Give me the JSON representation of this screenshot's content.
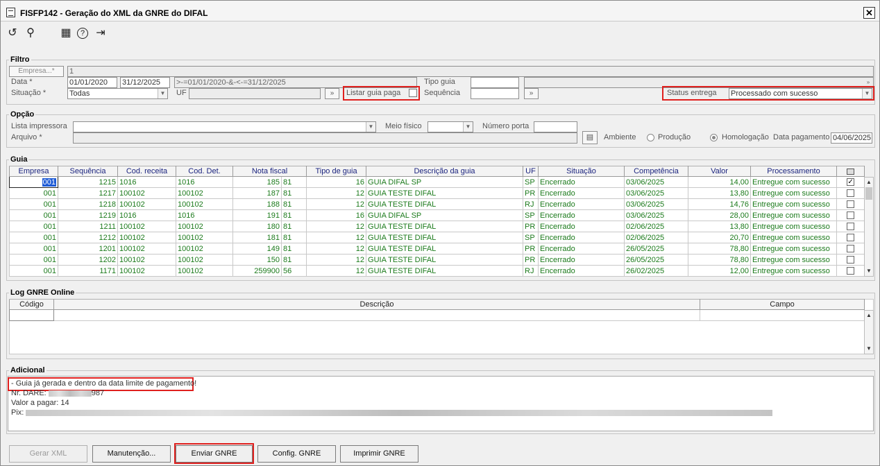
{
  "window": {
    "title": "FISFP142 - Geração do XML da GNRE do DIFAL",
    "close_label": "✕"
  },
  "toolbar": {
    "undo_glyph": "↺",
    "search_glyph": "⚲",
    "calendar_glyph": "▦",
    "help_glyph": "?",
    "exit_glyph": "⇥"
  },
  "filtro": {
    "group_label": "Filtro",
    "empresa_button": "Empresa...*",
    "empresa_value": "1",
    "data_label": "Data *",
    "data_from": "01/01/2020",
    "data_to": "31/12/2025",
    "data_expr": ">-=01/01/2020-&-<-=31/12/2025",
    "tipo_guia_label": "Tipo guia",
    "tipo_guia_value": "",
    "situacao_label": "Situação *",
    "situacao_value": "Todas",
    "uf_label": "UF",
    "uf_value": "",
    "listar_guia_paga_label": "Listar guia paga",
    "sequencia_label": "Sequência",
    "sequencia_value": "",
    "status_entrega_label": "Status entrega",
    "status_entrega_value": "Processado com sucesso",
    "lookup_glyph": "»"
  },
  "opcao": {
    "group_label": "Opção",
    "lista_impressora_label": "Lista impressora",
    "lista_impressora_value": "",
    "meio_fisico_label": "Meio físico",
    "meio_fisico_value": "",
    "numero_porta_label": "Número porta",
    "numero_porta_value": "",
    "arquivo_label": "Arquivo *",
    "arquivo_value": "",
    "ambiente_label": "Ambiente",
    "producao_label": "Produção",
    "homologacao_label": "Homologação",
    "data_pagamento_label": "Data pagamento",
    "data_pagamento_value": "04/06/2025",
    "browse_glyph": "▤"
  },
  "guia": {
    "group_label": "Guia",
    "columns": [
      "Empresa",
      "Sequência",
      "Cod. receita",
      "Cod. Det.",
      "Nota fiscal",
      "Tipo de guia",
      "Descrição da guia",
      "UF",
      "Situação",
      "Competência",
      "Valor",
      "Processamento"
    ],
    "rows": [
      {
        "empresa": "001",
        "sequencia": "1215",
        "cod_receita": "1016",
        "cod_det": "1016",
        "nf": "185",
        "nf2": "81",
        "tipo": "16",
        "descricao": "GUIA DIFAL SP",
        "uf": "SP",
        "situacao": "Encerrado",
        "competencia": "03/06/2025",
        "valor": "14,00",
        "processamento": "Entregue com sucesso",
        "checked": true
      },
      {
        "empresa": "001",
        "sequencia": "1217",
        "cod_receita": "100102",
        "cod_det": "100102",
        "nf": "187",
        "nf2": "81",
        "tipo": "12",
        "descricao": "GUIA TESTE DIFAL",
        "uf": "PR",
        "situacao": "Encerrado",
        "competencia": "03/06/2025",
        "valor": "13,80",
        "processamento": "Entregue com sucesso",
        "checked": false
      },
      {
        "empresa": "001",
        "sequencia": "1218",
        "cod_receita": "100102",
        "cod_det": "100102",
        "nf": "188",
        "nf2": "81",
        "tipo": "12",
        "descricao": "GUIA TESTE DIFAL",
        "uf": "RJ",
        "situacao": "Encerrado",
        "competencia": "03/06/2025",
        "valor": "14,76",
        "processamento": "Entregue com sucesso",
        "checked": false
      },
      {
        "empresa": "001",
        "sequencia": "1219",
        "cod_receita": "1016",
        "cod_det": "1016",
        "nf": "191",
        "nf2": "81",
        "tipo": "16",
        "descricao": "GUIA DIFAL SP",
        "uf": "SP",
        "situacao": "Encerrado",
        "competencia": "03/06/2025",
        "valor": "28,00",
        "processamento": "Entregue com sucesso",
        "checked": false
      },
      {
        "empresa": "001",
        "sequencia": "1211",
        "cod_receita": "100102",
        "cod_det": "100102",
        "nf": "180",
        "nf2": "81",
        "tipo": "12",
        "descricao": "GUIA TESTE DIFAL",
        "uf": "PR",
        "situacao": "Encerrado",
        "competencia": "02/06/2025",
        "valor": "13,80",
        "processamento": "Entregue com sucesso",
        "checked": false
      },
      {
        "empresa": "001",
        "sequencia": "1212",
        "cod_receita": "100102",
        "cod_det": "100102",
        "nf": "181",
        "nf2": "81",
        "tipo": "12",
        "descricao": "GUIA TESTE DIFAL",
        "uf": "SP",
        "situacao": "Encerrado",
        "competencia": "02/06/2025",
        "valor": "20,70",
        "processamento": "Entregue com sucesso",
        "checked": false
      },
      {
        "empresa": "001",
        "sequencia": "1201",
        "cod_receita": "100102",
        "cod_det": "100102",
        "nf": "149",
        "nf2": "81",
        "tipo": "12",
        "descricao": "GUIA TESTE DIFAL",
        "uf": "PR",
        "situacao": "Encerrado",
        "competencia": "26/05/2025",
        "valor": "78,80",
        "processamento": "Entregue com sucesso",
        "checked": false
      },
      {
        "empresa": "001",
        "sequencia": "1202",
        "cod_receita": "100102",
        "cod_det": "100102",
        "nf": "150",
        "nf2": "81",
        "tipo": "12",
        "descricao": "GUIA TESTE DIFAL",
        "uf": "PR",
        "situacao": "Encerrado",
        "competencia": "26/05/2025",
        "valor": "78,80",
        "processamento": "Entregue com sucesso",
        "checked": false
      },
      {
        "empresa": "001",
        "sequencia": "1171",
        "cod_receita": "100102",
        "cod_det": "100102",
        "nf": "259900",
        "nf2": "56",
        "tipo": "12",
        "descricao": "GUIA TESTE DIFAL",
        "uf": "RJ",
        "situacao": "Encerrado",
        "competencia": "26/02/2025",
        "valor": "12,00",
        "processamento": "Entregue com sucesso",
        "checked": false
      }
    ]
  },
  "log": {
    "group_label": "Log GNRE Online",
    "columns": [
      "Código",
      "Descrição",
      "Campo"
    ]
  },
  "adicional": {
    "group_label": "Adicional",
    "line1": "- Guia já gerada e dentro da data limite de pagamento!",
    "line2_prefix": "Nr. DARE: ",
    "line2_suffix": "987",
    "line3": "Valor a pagar: 14",
    "line4_prefix": "Pix: "
  },
  "buttons": {
    "gerar_xml": "Gerar XML",
    "manutencao": "Manutenção...",
    "enviar_gnre": "Enviar GNRE",
    "config_gnre": "Config. GNRE",
    "imprimir_gnre": "Imprimir GNRE"
  },
  "colors": {
    "accent_red": "#e0201e",
    "row_text": "#1b7a1b",
    "header_text": "#1a237e"
  }
}
